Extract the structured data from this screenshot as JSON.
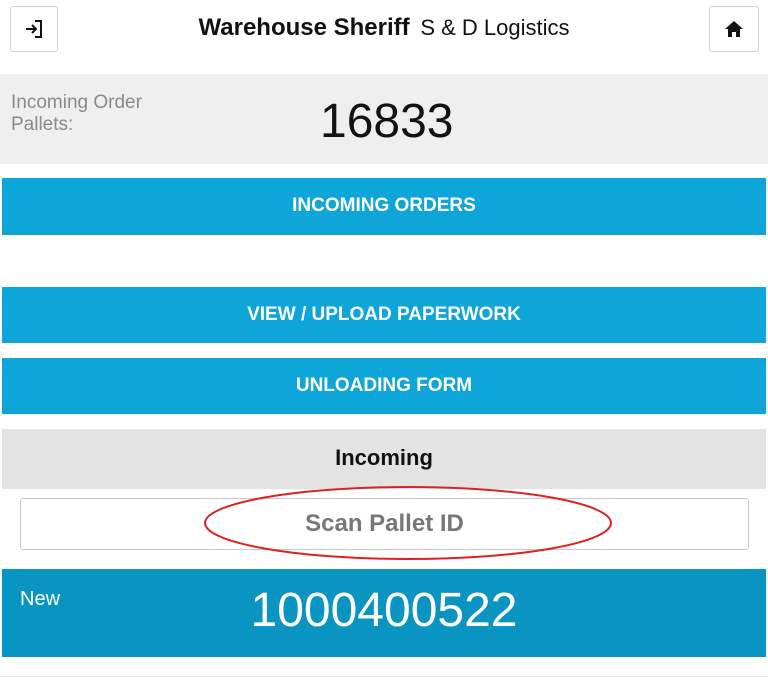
{
  "header": {
    "title_bold": "Warehouse Sheriff",
    "title_sub": "S & D Logistics",
    "left_icon": "login-icon",
    "right_icon": "home-icon"
  },
  "pallets": {
    "label": "Incoming Order Pallets:",
    "value": "16833"
  },
  "buttons": {
    "incoming_orders": "INCOMING ORDERS",
    "paperwork": "VIEW / UPLOAD PAPERWORK",
    "unloading_form": "UNLOADING FORM"
  },
  "section": {
    "title": "Incoming"
  },
  "scan": {
    "placeholder": "Scan Pallet ID",
    "highlight_color": "#e02020"
  },
  "new_item": {
    "label": "New",
    "value": "1000400522"
  },
  "colors": {
    "button_blue": "#0ea5d8",
    "panel_blue": "#0a94c2",
    "gray_bar": "#e3e3e3"
  }
}
